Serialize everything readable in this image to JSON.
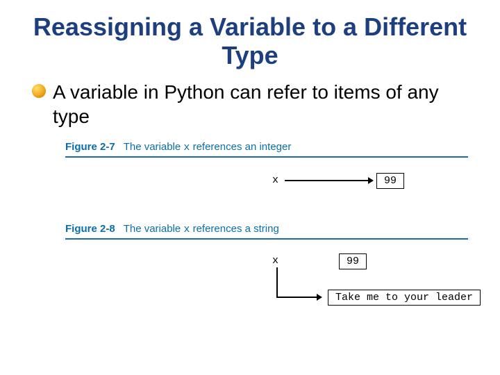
{
  "title": "Reassigning a Variable to a Different Type",
  "bullet1": "A variable in Python can refer to items of any type",
  "fig1": {
    "label": "Figure 2-7",
    "caption_pre": "The variable ",
    "caption_code": "x",
    "caption_post": " references an integer",
    "var": "x",
    "value": "99"
  },
  "fig2": {
    "label": "Figure 2-8",
    "caption_pre": "The variable ",
    "caption_code": "x",
    "caption_post": " references a string",
    "var": "x",
    "old_value": "99",
    "new_value": "Take me to your leader"
  }
}
